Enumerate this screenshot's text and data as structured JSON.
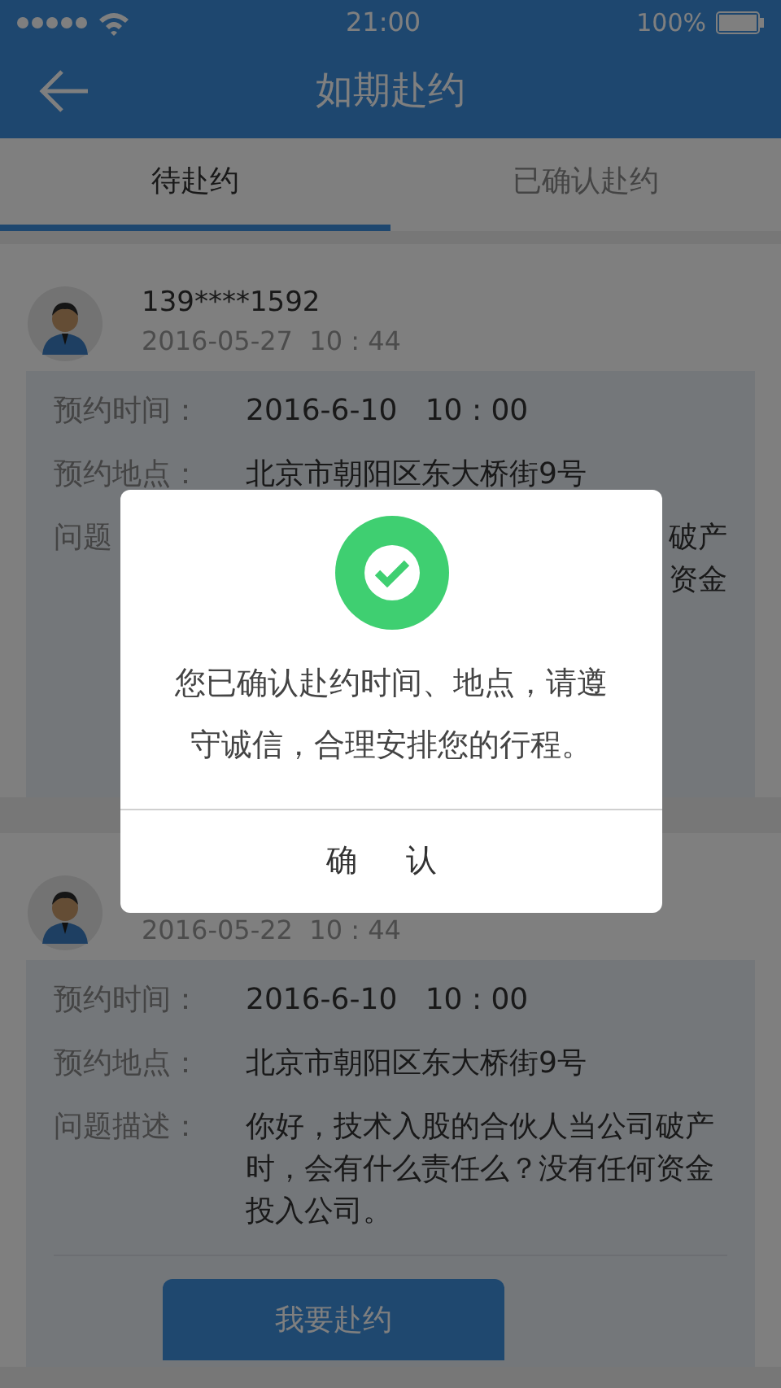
{
  "status_bar": {
    "time": "21:00",
    "battery": "100%"
  },
  "header": {
    "title": "如期赴约"
  },
  "tabs": [
    {
      "label": "待赴约",
      "selected": true
    },
    {
      "label": "已确认赴约",
      "selected": false
    }
  ],
  "appointments": [
    {
      "phone": "139****1592",
      "posted": "2016-05-27  10 : 44",
      "fields": [
        {
          "label": "预约时间：",
          "value": "2016-6-10   10 : 00"
        },
        {
          "label": "预约地点：",
          "value": "北京市朝阳区东大桥街9号"
        }
      ],
      "covered_description": {
        "label": "问题",
        "tail_lines": [
          "破产",
          "资金"
        ]
      }
    },
    {
      "posted": "2016-05-22  10 : 44",
      "fields": [
        {
          "label": "预约时间：",
          "value": "2016-6-10   10 : 00"
        },
        {
          "label": "预约地点：",
          "value": "北京市朝阳区东大桥街9号"
        },
        {
          "label": "问题描述：",
          "value": "你好，技术入股的合伙人当公司破产时，会有什么责任么？没有任何资金投入公司。"
        }
      ],
      "button": "我要赴约"
    }
  ],
  "dialog": {
    "message": "您已确认赴约时间、地点，请遵守诚信，合理安排您的行程。",
    "confirm": "确 认"
  }
}
